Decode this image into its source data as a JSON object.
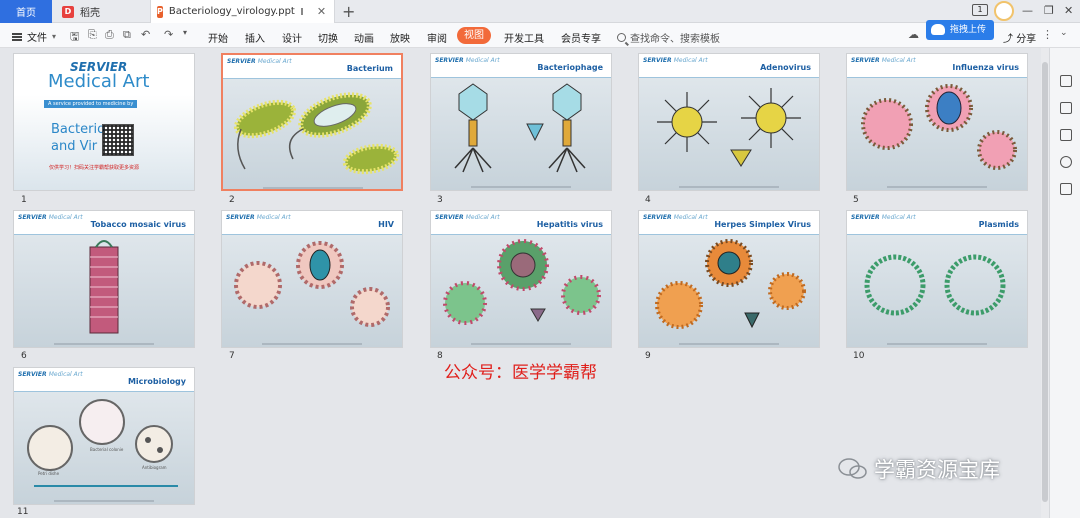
{
  "tabs": {
    "home": "首页",
    "docer": "稻壳",
    "active_file": "Bacteriology_virology.ppt"
  },
  "ribbon": {
    "file_menu": "文件",
    "tabs": [
      "开始",
      "插入",
      "设计",
      "切换",
      "动画",
      "放映",
      "审阅",
      "视图",
      "开发工具",
      "会员专享"
    ],
    "active_tab": "视图",
    "search_placeholder": "查找命令、搜索模板",
    "upload_button": "拖拽上传",
    "share": "分享",
    "counter": "1"
  },
  "cover": {
    "brand": "SERVIER",
    "brand_sub": "Medical Art",
    "tagline": "A service provided to medicine by",
    "title_line1": "Bacterio",
    "title_line2": "and Vir",
    "promo_text": "仅供学习！扫码关注学霸帮获取更多资源"
  },
  "slides": [
    {
      "num": "1",
      "title": ""
    },
    {
      "num": "2",
      "title": "Bacterium"
    },
    {
      "num": "3",
      "title": "Bacteriophage"
    },
    {
      "num": "4",
      "title": "Adenovirus"
    },
    {
      "num": "5",
      "title": "Influenza virus"
    },
    {
      "num": "6",
      "title": "Tobacco mosaic virus"
    },
    {
      "num": "7",
      "title": "HIV"
    },
    {
      "num": "8",
      "title": "Hepatitis virus"
    },
    {
      "num": "9",
      "title": "Herpes Simplex Virus"
    },
    {
      "num": "10",
      "title": "Plasmids"
    },
    {
      "num": "11",
      "title": "Microbiology"
    }
  ],
  "slide_brand": {
    "name": "SERVIER",
    "sub": "Medical Art"
  },
  "microbiology_labels": [
    "Petri dishe",
    "Bacterial colonie",
    "Antibiogram"
  ],
  "watermarks": {
    "red_text": "公众号：医学学霸帮",
    "logo_text": "学霸资源宝库"
  }
}
